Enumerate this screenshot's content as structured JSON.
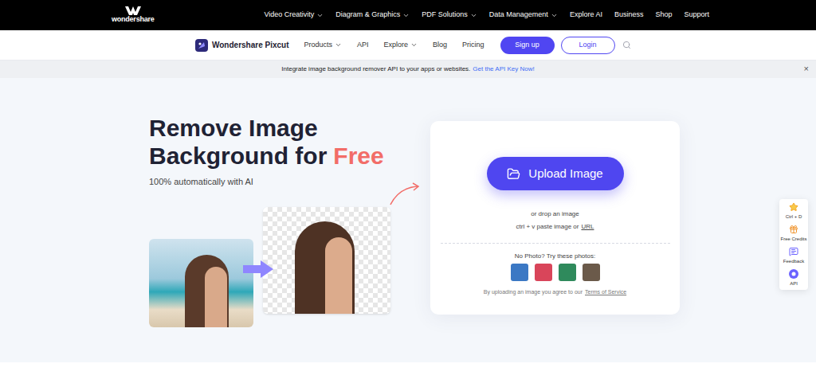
{
  "topbar": {
    "brand": "wondershare",
    "nav": [
      {
        "label": "Video Creativity",
        "dropdown": true
      },
      {
        "label": "Diagram & Graphics",
        "dropdown": true
      },
      {
        "label": "PDF Solutions",
        "dropdown": true
      },
      {
        "label": "Data Management",
        "dropdown": true
      },
      {
        "label": "Explore AI",
        "dropdown": false
      },
      {
        "label": "Business",
        "dropdown": false
      },
      {
        "label": "Shop",
        "dropdown": false
      },
      {
        "label": "Support",
        "dropdown": false
      }
    ]
  },
  "subnav": {
    "brand": "Wondershare Pixcut",
    "nav": [
      {
        "label": "Products",
        "dropdown": true
      },
      {
        "label": "API",
        "dropdown": false
      },
      {
        "label": "Explore",
        "dropdown": true
      },
      {
        "label": "Blog",
        "dropdown": false
      },
      {
        "label": "Pricing",
        "dropdown": false
      }
    ],
    "signup": "Sign up",
    "login": "Login"
  },
  "banner": {
    "text": "Integrate image background remover API to your apps or websites.",
    "link": "Get the API Key Now!",
    "close": "×"
  },
  "hero": {
    "title": [
      "Remove Image",
      "Background for"
    ],
    "highlight": "Free",
    "subtitle": "100% automatically with AI"
  },
  "upload": {
    "button": "Upload Image",
    "drop": "or drop an image",
    "paste": "ctrl + v paste image or",
    "paste_link": "URL",
    "samples_label": "No Photo? Try these photos:",
    "samples": [
      {
        "color": "#3b78c4"
      },
      {
        "color": "#d9455a"
      },
      {
        "color": "#2f8a5c"
      },
      {
        "color": "#6b5a4a"
      }
    ],
    "terms": "By uploading an image you agree to our",
    "terms_link": "Terms of Service"
  },
  "side_tools": [
    {
      "label": "Ctrl + D"
    },
    {
      "label": "Free Credits"
    },
    {
      "label": "Feedback"
    },
    {
      "label": "API"
    }
  ]
}
